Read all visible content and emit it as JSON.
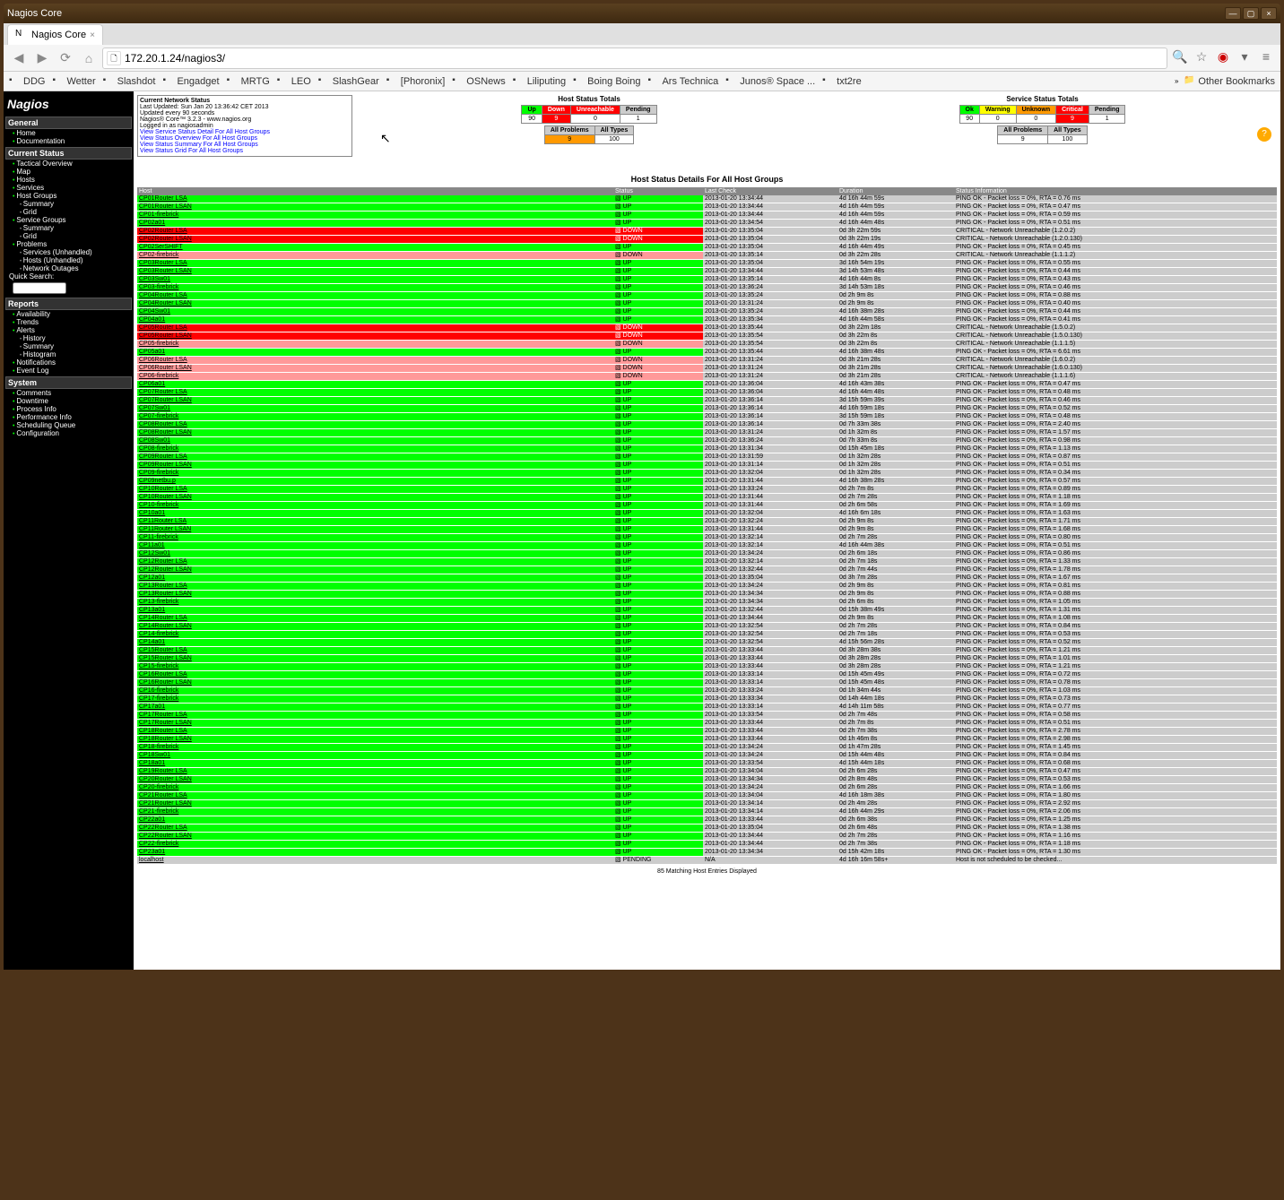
{
  "window": {
    "title": "Nagios Core"
  },
  "tab": {
    "label": "Nagios Core"
  },
  "url": "172.20.1.24/nagios3/",
  "bookmarks": [
    "DDG",
    "Wetter",
    "Slashdot",
    "Engadget",
    "MRTG",
    "LEO",
    "SlashGear",
    "[Phoronix]",
    "OSNews",
    "Liliputing",
    "Boing Boing",
    "Ars Technica",
    "Junos® Space ...",
    "txt2re"
  ],
  "other_bookmarks": "Other Bookmarks",
  "sidebar": {
    "logo": "Nagios",
    "sections": [
      {
        "title": "General",
        "items": [
          "Home",
          "Documentation"
        ]
      },
      {
        "title": "Current Status",
        "items": [
          "Tactical Overview",
          "Map",
          "Hosts",
          "Services",
          "Host Groups"
        ],
        "subs_after_4": [
          "Summary",
          "Grid"
        ],
        "items2": [
          "Service Groups"
        ],
        "subs_after_items2": [
          "Summary",
          "Grid"
        ],
        "items3": [
          "Problems"
        ],
        "subs_after_items3": [
          "Services (Unhandled)",
          "Hosts (Unhandled)",
          "Network Outages"
        ],
        "quick": "Quick Search:"
      },
      {
        "title": "Reports",
        "items": [
          "Availability",
          "Trends",
          "Alerts"
        ],
        "subs_after_2": [
          "History",
          "Summary",
          "Histogram"
        ],
        "items2": [
          "Notifications",
          "Event Log"
        ]
      },
      {
        "title": "System",
        "items": [
          "Comments",
          "Downtime",
          "Process Info",
          "Performance Info",
          "Scheduling Queue",
          "Configuration"
        ]
      }
    ]
  },
  "status_box": {
    "title": "Current Network Status",
    "updated": "Last Updated: Sun Jan 20 13:36:42 CET 2013",
    "refresh": "Updated every 90 seconds",
    "version": "Nagios® Core™ 3.2.3 - www.nagios.org",
    "login": "Logged in as nagiosadmin",
    "links": [
      "View Service Status Detail For All Host Groups",
      "View Status Overview For All Host Groups",
      "View Status Summary For All Host Groups",
      "View Status Grid For All Host Groups"
    ]
  },
  "host_totals": {
    "title": "Host Status Totals",
    "headers": [
      "Up",
      "Down",
      "Unreachable",
      "Pending"
    ],
    "values": [
      "90",
      "9",
      "0",
      "1"
    ],
    "headers2": [
      "All Problems",
      "All Types"
    ],
    "values2": [
      "9",
      "100"
    ]
  },
  "service_totals": {
    "title": "Service Status Totals",
    "headers": [
      "Ok",
      "Warning",
      "Unknown",
      "Critical",
      "Pending"
    ],
    "values": [
      "90",
      "0",
      "0",
      "9",
      "1"
    ],
    "headers2": [
      "All Problems",
      "All Types"
    ],
    "values2": [
      "9",
      "100"
    ]
  },
  "details_title": "Host Status Details For All Host Groups",
  "columns": [
    "Host",
    "Status",
    "Last Check",
    "Duration",
    "Status Information"
  ],
  "rows": [
    {
      "h": "CP01Router LSA",
      "s": "UP",
      "c": "st-up",
      "lc": "2013-01-20 13:34:44",
      "d": "4d 16h 44m 59s",
      "i": "PING OK - Packet loss = 0%, RTA = 0.76 ms"
    },
    {
      "h": "CP01Router LSAN",
      "s": "UP",
      "c": "st-up",
      "lc": "2013-01-20 13:34:44",
      "d": "4d 16h 44m 59s",
      "i": "PING OK - Packet loss = 0%, RTA = 0.47 ms"
    },
    {
      "h": "CP01-firebrick",
      "s": "UP",
      "c": "st-up",
      "lc": "2013-01-20 13:34:44",
      "d": "4d 16h 44m 59s",
      "i": "PING OK - Packet loss = 0%, RTA = 0.59 ms"
    },
    {
      "h": "CP02a01",
      "s": "UP",
      "c": "st-up",
      "lc": "2013-01-20 13:34:54",
      "d": "4d 16h 44m 48s",
      "i": "PING OK - Packet loss = 0%, RTA = 0.51 ms"
    },
    {
      "h": "CP02Router LSA",
      "s": "DOWN",
      "c": "st-down",
      "lc": "2013-01-20 13:35:04",
      "d": "0d 3h 22m 59s",
      "i": "CRITICAL - Network Unreachable (1.2.0.2)"
    },
    {
      "h": "CP02Router LSAN",
      "s": "DOWN",
      "c": "st-down",
      "lc": "2013-01-20 13:35:04",
      "d": "0d 3h 22m 19s",
      "i": "CRITICAL - Network Unreachable (1.2.0.130)"
    },
    {
      "h": "CP02SerSHIFT",
      "s": "UP",
      "c": "st-up",
      "lc": "2013-01-20 13:35:04",
      "d": "4d 16h 44m 49s",
      "i": "PING OK - Packet loss = 0%, RTA = 0.45 ms"
    },
    {
      "h": "CP02-firebrick",
      "s": "DOWN",
      "c": "st-downack",
      "lc": "2013-01-20 13:35:14",
      "d": "0d 3h 22m 28s",
      "i": "CRITICAL - Network Unreachable (1.1.1.2)"
    },
    {
      "h": "CP03Router LSA",
      "s": "UP",
      "c": "st-up",
      "lc": "2013-01-20 13:35:04",
      "d": "3d 16h 54m 19s",
      "i": "PING OK - Packet loss = 0%, RTA = 0.55 ms"
    },
    {
      "h": "CP03Router LSAN",
      "s": "UP",
      "c": "st-up",
      "lc": "2013-01-20 13:34:44",
      "d": "3d 14h 53m 48s",
      "i": "PING OK - Packet loss = 0%, RTA = 0.44 ms"
    },
    {
      "h": "CP03Sw01",
      "s": "UP",
      "c": "st-up",
      "lc": "2013-01-20 13:35:14",
      "d": "4d 16h 44m 8s",
      "i": "PING OK - Packet loss = 0%, RTA = 0.43 ms"
    },
    {
      "h": "CP03-firebrick",
      "s": "UP",
      "c": "st-up",
      "lc": "2013-01-20 13:36:24",
      "d": "3d 14h 53m 18s",
      "i": "PING OK - Packet loss = 0%, RTA = 0.46 ms"
    },
    {
      "h": "CP04Router LSA",
      "s": "UP",
      "c": "st-up",
      "lc": "2013-01-20 13:35:24",
      "d": "0d 2h 9m 8s",
      "i": "PING OK - Packet loss = 0%, RTA = 0.88 ms"
    },
    {
      "h": "CP04Router LSAN",
      "s": "UP",
      "c": "st-up",
      "lc": "2013-01-20 13:31:24",
      "d": "0d 2h 9m 8s",
      "i": "PING OK - Packet loss = 0%, RTA = 0.40 ms"
    },
    {
      "h": "CP04Sw01",
      "s": "UP",
      "c": "st-up",
      "lc": "2013-01-20 13:35:24",
      "d": "4d 16h 38m 28s",
      "i": "PING OK - Packet loss = 0%, RTA = 0.44 ms"
    },
    {
      "h": "CP04a01",
      "s": "UP",
      "c": "st-up",
      "lc": "2013-01-20 13:35:34",
      "d": "4d 16h 44m 58s",
      "i": "PING OK - Packet loss = 0%, RTA = 0.41 ms"
    },
    {
      "h": "CP05Router LSA",
      "s": "DOWN",
      "c": "st-down",
      "lc": "2013-01-20 13:35:44",
      "d": "0d 3h 22m 18s",
      "i": "CRITICAL - Network Unreachable (1.5.0.2)"
    },
    {
      "h": "CP05Router LSAN",
      "s": "DOWN",
      "c": "st-down",
      "lc": "2013-01-20 13:35:54",
      "d": "0d 3h 22m 8s",
      "i": "CRITICAL - Network Unreachable (1.5.0.130)"
    },
    {
      "h": "CP05-firebrick",
      "s": "DOWN",
      "c": "st-downack",
      "lc": "2013-01-20 13:35:54",
      "d": "0d 3h 22m 8s",
      "i": "CRITICAL - Network Unreachable (1.1.1.5)"
    },
    {
      "h": "CP05a01",
      "s": "UP",
      "c": "st-up",
      "lc": "2013-01-20 13:35:44",
      "d": "4d 16h 38m 48s",
      "i": "PING OK - Packet loss = 0%, RTA = 6.61 ms"
    },
    {
      "h": "CP06Router LSA",
      "s": "DOWN",
      "c": "st-downack",
      "lc": "2013-01-20 13:31:24",
      "d": "0d 3h 21m 28s",
      "i": "CRITICAL - Network Unreachable (1.6.0.2)"
    },
    {
      "h": "CP06Router LSAN",
      "s": "DOWN",
      "c": "st-downack",
      "lc": "2013-01-20 13:31:24",
      "d": "0d 3h 21m 28s",
      "i": "CRITICAL - Network Unreachable (1.6.0.130)"
    },
    {
      "h": "CP06-firebrick",
      "s": "DOWN",
      "c": "st-downack",
      "lc": "2013-01-20 13:31:24",
      "d": "0d 3h 21m 28s",
      "i": "CRITICAL - Network Unreachable (1.1.1.6)"
    },
    {
      "h": "CP06a01",
      "s": "UP",
      "c": "st-up",
      "lc": "2013-01-20 13:36:04",
      "d": "4d 16h 43m 38s",
      "i": "PING OK - Packet loss = 0%, RTA = 0.47 ms"
    },
    {
      "h": "CP07Router LSA",
      "s": "UP",
      "c": "st-up",
      "lc": "2013-01-20 13:36:04",
      "d": "4d 16h 44m 48s",
      "i": "PING OK - Packet loss = 0%, RTA = 0.48 ms"
    },
    {
      "h": "CP07Router LSAN",
      "s": "UP",
      "c": "st-up",
      "lc": "2013-01-20 13:36:14",
      "d": "3d 15h 59m 39s",
      "i": "PING OK - Packet loss = 0%, RTA = 0.46 ms"
    },
    {
      "h": "CP07Sw01",
      "s": "UP",
      "c": "st-up",
      "lc": "2013-01-20 13:36:14",
      "d": "4d 16h 59m 18s",
      "i": "PING OK - Packet loss = 0%, RTA = 0.52 ms"
    },
    {
      "h": "CP07-firebrick",
      "s": "UP",
      "c": "st-up",
      "lc": "2013-01-20 13:36:14",
      "d": "3d 15h 59m 18s",
      "i": "PING OK - Packet loss = 0%, RTA = 0.48 ms"
    },
    {
      "h": "CP08Router LSA",
      "s": "UP",
      "c": "st-up",
      "lc": "2013-01-20 13:36:14",
      "d": "0d 7h 33m 38s",
      "i": "PING OK - Packet loss = 0%, RTA = 2.40 ms"
    },
    {
      "h": "CP08Router LSAN",
      "s": "UP",
      "c": "st-up",
      "lc": "2013-01-20 13:31:24",
      "d": "0d 1h 32m 8s",
      "i": "PING OK - Packet loss = 0%, RTA = 1.57 ms"
    },
    {
      "h": "CP08Sw01",
      "s": "UP",
      "c": "st-up",
      "lc": "2013-01-20 13:36:24",
      "d": "0d 7h 33m 8s",
      "i": "PING OK - Packet loss = 0%, RTA = 0.98 ms"
    },
    {
      "h": "CP08-firebrick",
      "s": "UP",
      "c": "st-up",
      "lc": "2013-01-20 13:31:34",
      "d": "0d 15h 45m 18s",
      "i": "PING OK - Packet loss = 0%, RTA = 1.13 ms"
    },
    {
      "h": "CP09Router LSA",
      "s": "UP",
      "c": "st-up",
      "lc": "2013-01-20 13:31:59",
      "d": "0d 1h 32m 28s",
      "i": "PING OK - Packet loss = 0%, RTA = 0.87 ms"
    },
    {
      "h": "CP09Router LSAN",
      "s": "UP",
      "c": "st-up",
      "lc": "2013-01-20 13:31:14",
      "d": "0d 1h 32m 28s",
      "i": "PING OK - Packet loss = 0%, RTA = 0.51 ms"
    },
    {
      "h": "CP09-firebrick",
      "s": "UP",
      "c": "st-up",
      "lc": "2013-01-20 13:32:04",
      "d": "0d 1h 32m 28s",
      "i": "PING OK - Packet loss = 0%, RTA = 0.34 ms"
    },
    {
      "h": "CP09netbu.p",
      "s": "UP",
      "c": "st-up",
      "lc": "2013-01-20 13:31:44",
      "d": "4d 16h 38m 28s",
      "i": "PING OK - Packet loss = 0%, RTA = 0.57 ms"
    },
    {
      "h": "CP10Router LSA",
      "s": "UP",
      "c": "st-up",
      "lc": "2013-01-20 13:33:24",
      "d": "0d 2h 7m 8s",
      "i": "PING OK - Packet loss = 0%, RTA = 0.89 ms"
    },
    {
      "h": "CP10Router LSAN",
      "s": "UP",
      "c": "st-up",
      "lc": "2013-01-20 13:31:44",
      "d": "0d 2h 7m 28s",
      "i": "PING OK - Packet loss = 0%, RTA = 1.18 ms"
    },
    {
      "h": "CP10-firebrick",
      "s": "UP",
      "c": "st-up",
      "lc": "2013-01-20 13:31:44",
      "d": "0d 2h 6m 58s",
      "i": "PING OK - Packet loss = 0%, RTA = 1.69 ms"
    },
    {
      "h": "CP10a01",
      "s": "UP",
      "c": "st-up",
      "lc": "2013-01-20 13:32:04",
      "d": "4d 16h 6m 18s",
      "i": "PING OK - Packet loss = 0%, RTA = 1.63 ms"
    },
    {
      "h": "CP11Router LSA",
      "s": "UP",
      "c": "st-up",
      "lc": "2013-01-20 13:32:24",
      "d": "0d 2h 9m 8s",
      "i": "PING OK - Packet loss = 0%, RTA = 1.71 ms"
    },
    {
      "h": "CP11Router LSAN",
      "s": "UP",
      "c": "st-up",
      "lc": "2013-01-20 13:31:44",
      "d": "0d 2h 9m 8s",
      "i": "PING OK - Packet loss = 0%, RTA = 1.68 ms"
    },
    {
      "h": "CP11-firebrick",
      "s": "UP",
      "c": "st-up",
      "lc": "2013-01-20 13:32:14",
      "d": "0d 2h 7m 28s",
      "i": "PING OK - Packet loss = 0%, RTA = 0.80 ms"
    },
    {
      "h": "CP11a01",
      "s": "UP",
      "c": "st-up",
      "lc": "2013-01-20 13:32:14",
      "d": "4d 16h 44m 38s",
      "i": "PING OK - Packet loss = 0%, RTA = 0.51 ms"
    },
    {
      "h": "CP12Sw01",
      "s": "UP",
      "c": "st-up",
      "lc": "2013-01-20 13:34:24",
      "d": "0d 2h 6m 18s",
      "i": "PING OK - Packet loss = 0%, RTA = 0.86 ms"
    },
    {
      "h": "CP12Router LSA",
      "s": "UP",
      "c": "st-up",
      "lc": "2013-01-20 13:32:14",
      "d": "0d 2h 7m 18s",
      "i": "PING OK - Packet loss = 0%, RTA = 1.33 ms"
    },
    {
      "h": "CP12Router LSAN",
      "s": "UP",
      "c": "st-up",
      "lc": "2013-01-20 13:32:44",
      "d": "0d 2h 7m 44s",
      "i": "PING OK - Packet loss = 0%, RTA = 1.78 ms"
    },
    {
      "h": "CP12a01",
      "s": "UP",
      "c": "st-up",
      "lc": "2013-01-20 13:35:04",
      "d": "0d 3h 7m 28s",
      "i": "PING OK - Packet loss = 0%, RTA = 1.67 ms"
    },
    {
      "h": "CP13Router LSA",
      "s": "UP",
      "c": "st-up",
      "lc": "2013-01-20 13:34:24",
      "d": "0d 2h 9m 8s",
      "i": "PING OK - Packet loss = 0%, RTA = 0.81 ms"
    },
    {
      "h": "CP13Router LSAN",
      "s": "UP",
      "c": "st-up",
      "lc": "2013-01-20 13:34:34",
      "d": "0d 2h 9m 8s",
      "i": "PING OK - Packet loss = 0%, RTA = 0.88 ms"
    },
    {
      "h": "CP13-firebrick",
      "s": "UP",
      "c": "st-up",
      "lc": "2013-01-20 13:34:34",
      "d": "0d 2h 6m 8s",
      "i": "PING OK - Packet loss = 0%, RTA = 1.05 ms"
    },
    {
      "h": "CP13a01",
      "s": "UP",
      "c": "st-up",
      "lc": "2013-01-20 13:32:44",
      "d": "0d 15h 38m 49s",
      "i": "PING OK - Packet loss = 0%, RTA = 1.31 ms"
    },
    {
      "h": "CP14Router LSA",
      "s": "UP",
      "c": "st-up",
      "lc": "2013-01-20 13:34:44",
      "d": "0d 2h 9m 8s",
      "i": "PING OK - Packet loss = 0%, RTA = 1.08 ms"
    },
    {
      "h": "CP14Router LSAN",
      "s": "UP",
      "c": "st-up",
      "lc": "2013-01-20 13:32:54",
      "d": "0d 2h 7m 28s",
      "i": "PING OK - Packet loss = 0%, RTA = 0.84 ms"
    },
    {
      "h": "CP14-firebrick",
      "s": "UP",
      "c": "st-up",
      "lc": "2013-01-20 13:32:54",
      "d": "0d 2h 7m 18s",
      "i": "PING OK - Packet loss = 0%, RTA = 0.53 ms"
    },
    {
      "h": "CP14a01",
      "s": "UP",
      "c": "st-up",
      "lc": "2013-01-20 13:32:54",
      "d": "4d 15h 56m 28s",
      "i": "PING OK - Packet loss = 0%, RTA = 0.52 ms"
    },
    {
      "h": "CP15Router LSA",
      "s": "UP",
      "c": "st-up",
      "lc": "2013-01-20 13:33:44",
      "d": "0d 3h 28m 38s",
      "i": "PING OK - Packet loss = 0%, RTA = 1.21 ms"
    },
    {
      "h": "CP15Router LSAN",
      "s": "UP",
      "c": "st-up",
      "lc": "2013-01-20 13:33:44",
      "d": "0d 3h 28m 28s",
      "i": "PING OK - Packet loss = 0%, RTA = 1.01 ms"
    },
    {
      "h": "CP15-firebrick",
      "s": "UP",
      "c": "st-up",
      "lc": "2013-01-20 13:33:44",
      "d": "0d 3h 28m 28s",
      "i": "PING OK - Packet loss = 0%, RTA = 1.21 ms"
    },
    {
      "h": "CP16Router LSA",
      "s": "UP",
      "c": "st-up",
      "lc": "2013-01-20 13:33:14",
      "d": "0d 15h 45m 49s",
      "i": "PING OK - Packet loss = 0%, RTA = 0.72 ms"
    },
    {
      "h": "CP16Router LSAN",
      "s": "UP",
      "c": "st-up",
      "lc": "2013-01-20 13:33:14",
      "d": "0d 15h 45m 48s",
      "i": "PING OK - Packet loss = 0%, RTA = 0.78 ms"
    },
    {
      "h": "CP16-firebrick",
      "s": "UP",
      "c": "st-up",
      "lc": "2013-01-20 13:33:24",
      "d": "0d 1h 34m 44s",
      "i": "PING OK - Packet loss = 0%, RTA = 1.03 ms"
    },
    {
      "h": "CP17-firebrick",
      "s": "UP",
      "c": "st-up",
      "lc": "2013-01-20 13:33:34",
      "d": "0d 14h 44m 18s",
      "i": "PING OK - Packet loss = 0%, RTA = 0.73 ms"
    },
    {
      "h": "CP17a01",
      "s": "UP",
      "c": "st-up",
      "lc": "2013-01-20 13:33:14",
      "d": "4d 14h 11m 58s",
      "i": "PING OK - Packet loss = 0%, RTA = 0.77 ms"
    },
    {
      "h": "CP17Router LSA",
      "s": "UP",
      "c": "st-up",
      "lc": "2013-01-20 13:33:54",
      "d": "0d 2h 7m 48s",
      "i": "PING OK - Packet loss = 0%, RTA = 0.58 ms"
    },
    {
      "h": "CP17Router LSAN",
      "s": "UP",
      "c": "st-up",
      "lc": "2013-01-20 13:33:44",
      "d": "0d 2h 7m 8s",
      "i": "PING OK - Packet loss = 0%, RTA = 0.51 ms"
    },
    {
      "h": "CP18Router LSA",
      "s": "UP",
      "c": "st-up",
      "lc": "2013-01-20 13:33:44",
      "d": "0d 2h 7m 38s",
      "i": "PING OK - Packet loss = 0%, RTA = 2.78 ms"
    },
    {
      "h": "CP18Router LSAN",
      "s": "UP",
      "c": "st-up",
      "lc": "2013-01-20 13:33:44",
      "d": "0d 1h 46m 8s",
      "i": "PING OK - Packet loss = 0%, RTA = 2.98 ms"
    },
    {
      "h": "CP18-firebrick",
      "s": "UP",
      "c": "st-up",
      "lc": "2013-01-20 13:34:24",
      "d": "0d 1h 47m 28s",
      "i": "PING OK - Packet loss = 0%, RTA = 1.45 ms"
    },
    {
      "h": "CP18Sw01",
      "s": "UP",
      "c": "st-up",
      "lc": "2013-01-20 13:34:24",
      "d": "0d 15h 44m 48s",
      "i": "PING OK - Packet loss = 0%, RTA = 0.84 ms"
    },
    {
      "h": "CP18a01",
      "s": "UP",
      "c": "st-up",
      "lc": "2013-01-20 13:33:54",
      "d": "4d 15h 44m 18s",
      "i": "PING OK - Packet loss = 0%, RTA = 0.68 ms"
    },
    {
      "h": "CP19Router LSA",
      "s": "UP",
      "c": "st-up",
      "lc": "2013-01-20 13:34:04",
      "d": "0d 2h 6m 28s",
      "i": "PING OK - Packet loss = 0%, RTA = 0.47 ms"
    },
    {
      "h": "CP20Router LSAN",
      "s": "UP",
      "c": "st-up",
      "lc": "2013-01-20 13:34:34",
      "d": "0d 2h 8m 48s",
      "i": "PING OK - Packet loss = 0%, RTA = 0.53 ms"
    },
    {
      "h": "CP20-firebrick",
      "s": "UP",
      "c": "st-up",
      "lc": "2013-01-20 13:34:24",
      "d": "0d 2h 6m 28s",
      "i": "PING OK - Packet loss = 0%, RTA = 1.66 ms"
    },
    {
      "h": "CP21Router LSA",
      "s": "UP",
      "c": "st-up",
      "lc": "2013-01-20 13:34:04",
      "d": "4d 16h 18m 38s",
      "i": "PING OK - Packet loss = 0%, RTA = 1.80 ms"
    },
    {
      "h": "CP21Router LSAN",
      "s": "UP",
      "c": "st-up",
      "lc": "2013-01-20 13:34:14",
      "d": "0d 2h 4m 28s",
      "i": "PING OK - Packet loss = 0%, RTA = 2.92 ms"
    },
    {
      "h": "CP21-firebrick",
      "s": "UP",
      "c": "st-up",
      "lc": "2013-01-20 13:34:14",
      "d": "4d 16h 44m 29s",
      "i": "PING OK - Packet loss = 0%, RTA = 2.06 ms"
    },
    {
      "h": "CP22a01",
      "s": "UP",
      "c": "st-up",
      "lc": "2013-01-20 13:33:44",
      "d": "0d 2h 6m 38s",
      "i": "PING OK - Packet loss = 0%, RTA = 1.25 ms"
    },
    {
      "h": "CP22Router LSA",
      "s": "UP",
      "c": "st-up",
      "lc": "2013-01-20 13:35:04",
      "d": "0d 2h 6m 48s",
      "i": "PING OK - Packet loss = 0%, RTA = 1.38 ms"
    },
    {
      "h": "CP22Router LSAN",
      "s": "UP",
      "c": "st-up",
      "lc": "2013-01-20 13:34:44",
      "d": "0d 2h 7m 28s",
      "i": "PING OK - Packet loss = 0%, RTA = 1.16 ms"
    },
    {
      "h": "CP22-firebrick",
      "s": "UP",
      "c": "st-up",
      "lc": "2013-01-20 13:34:44",
      "d": "0d 2h 7m 38s",
      "i": "PING OK - Packet loss = 0%, RTA = 1.18 ms"
    },
    {
      "h": "CP23a01",
      "s": "UP",
      "c": "st-up",
      "lc": "2013-01-20 13:34:34",
      "d": "0d 15h 42m 18s",
      "i": "PING OK - Packet loss = 0%, RTA = 1.30 ms"
    },
    {
      "h": "localhost",
      "s": "PENDING",
      "c": "st-pending",
      "lc": "N/A",
      "d": "4d 16h 16m 58s+",
      "i": "Host is not scheduled to be checked..."
    }
  ],
  "footer": "85 Matching Host Entries Displayed"
}
